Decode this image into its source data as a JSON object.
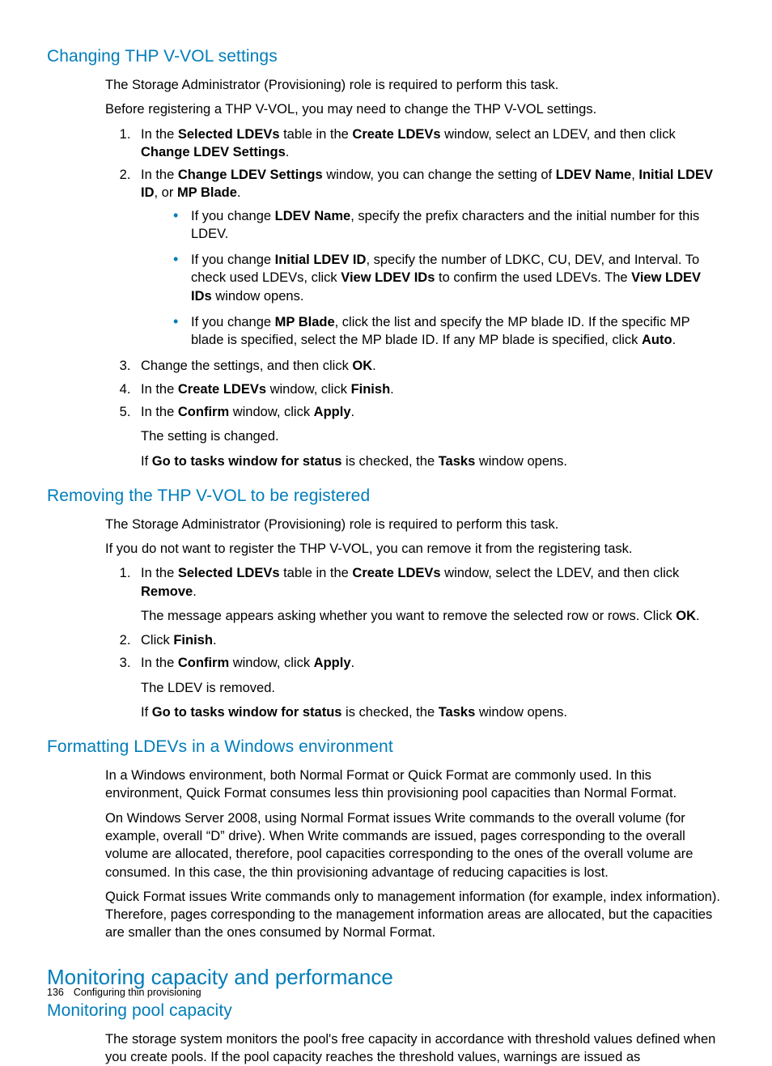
{
  "sections": {
    "s1": {
      "title": "Changing THP V-VOL settings",
      "intro1": "The Storage Administrator (Provisioning) role is required to perform this task.",
      "intro2": "Before registering a THP V-VOL, you may need to change the THP V-VOL settings.",
      "step1_a": "In the ",
      "step1_b": "Selected LDEVs",
      "step1_c": " table in the ",
      "step1_d": "Create LDEVs",
      "step1_e": " window, select an LDEV, and then click ",
      "step1_f": "Change LDEV Settings",
      "step1_g": ".",
      "step2_a": "In the ",
      "step2_b": "Change LDEV Settings",
      "step2_c": " window, you can change the setting of ",
      "step2_d": "LDEV Name",
      "step2_e": ", ",
      "step2_f": "Initial LDEV ID",
      "step2_g": ", or ",
      "step2_h": "MP Blade",
      "step2_i": ".",
      "b1_a": "If you change ",
      "b1_b": "LDEV Name",
      "b1_c": ", specify the prefix characters and the initial number for this LDEV.",
      "b2_a": "If you change ",
      "b2_b": "Initial LDEV ID",
      "b2_c": ", specify the number of LDKC, CU, DEV, and Interval. To check used LDEVs, click ",
      "b2_d": "View LDEV IDs",
      "b2_e": " to confirm the used LDEVs. The ",
      "b2_f": "View LDEV IDs",
      "b2_g": " window opens.",
      "b3_a": "If you change ",
      "b3_b": "MP Blade",
      "b3_c": ", click the list and specify the MP blade ID. If the specific MP blade is specified, select the MP blade ID. If any MP blade is specified, click ",
      "b3_d": "Auto",
      "b3_e": ".",
      "step3_a": "Change the settings, and then click ",
      "step3_b": "OK",
      "step3_c": ".",
      "step4_a": "In the ",
      "step4_b": "Create LDEVs",
      "step4_c": " window, click ",
      "step4_d": "Finish",
      "step4_e": ".",
      "step5_a": "In the ",
      "step5_b": "Confirm",
      "step5_c": " window, click ",
      "step5_d": "Apply",
      "step5_e": ".",
      "post1": "The setting is changed.",
      "post2_a": "If ",
      "post2_b": "Go to tasks window for status",
      "post2_c": " is checked, the ",
      "post2_d": "Tasks",
      "post2_e": " window opens."
    },
    "s2": {
      "title": "Removing the THP V-VOL to be registered",
      "intro1": "The Storage Administrator (Provisioning) role is required to perform this task.",
      "intro2": "If you do not want to register the THP V-VOL, you can remove it from the registering task.",
      "step1_a": "In the ",
      "step1_b": "Selected LDEVs",
      "step1_c": " table in the ",
      "step1_d": "Create LDEVs",
      "step1_e": " window, select the LDEV, and then click ",
      "step1_f": "Remove",
      "step1_g": ".",
      "msg_a": "The message appears asking whether you want to remove the selected row or rows. Click ",
      "msg_b": "OK",
      "msg_c": ".",
      "step2_a": "Click ",
      "step2_b": "Finish",
      "step2_c": ".",
      "step3_a": "In the ",
      "step3_b": "Confirm",
      "step3_c": " window, click ",
      "step3_d": "Apply",
      "step3_e": ".",
      "post1": "The LDEV is removed.",
      "post2_a": "If ",
      "post2_b": "Go to tasks window for status",
      "post2_c": " is checked, the ",
      "post2_d": "Tasks",
      "post2_e": " window opens."
    },
    "s3": {
      "title": "Formatting LDEVs in a Windows environment",
      "p1": "In a Windows environment, both Normal Format or Quick Format are commonly used. In this environment, Quick Format consumes less thin provisioning pool capacities than Normal Format.",
      "p2": "On Windows Server 2008, using Normal Format issues Write commands to the overall volume (for example, overall “D” drive). When Write commands are issued, pages corresponding to the overall volume are allocated, therefore, pool capacities corresponding to the ones of the overall volume are consumed. In this case, the thin provisioning advantage of reducing capacities is lost.",
      "p3": "Quick Format issues Write commands only to management information (for example, index information). Therefore, pages corresponding to the management information areas are allocated, but the capacities are smaller than the ones consumed by Normal Format."
    },
    "s4": {
      "title_major": "Monitoring capacity and performance",
      "title_sub": "Monitoring pool capacity",
      "p1": "The storage system monitors the pool's free capacity in accordance with threshold values defined when you create pools. If the pool capacity reaches the threshold values, warnings are issued as"
    }
  },
  "footer": {
    "page": "136",
    "chapter": "Configuring thin provisioning"
  }
}
